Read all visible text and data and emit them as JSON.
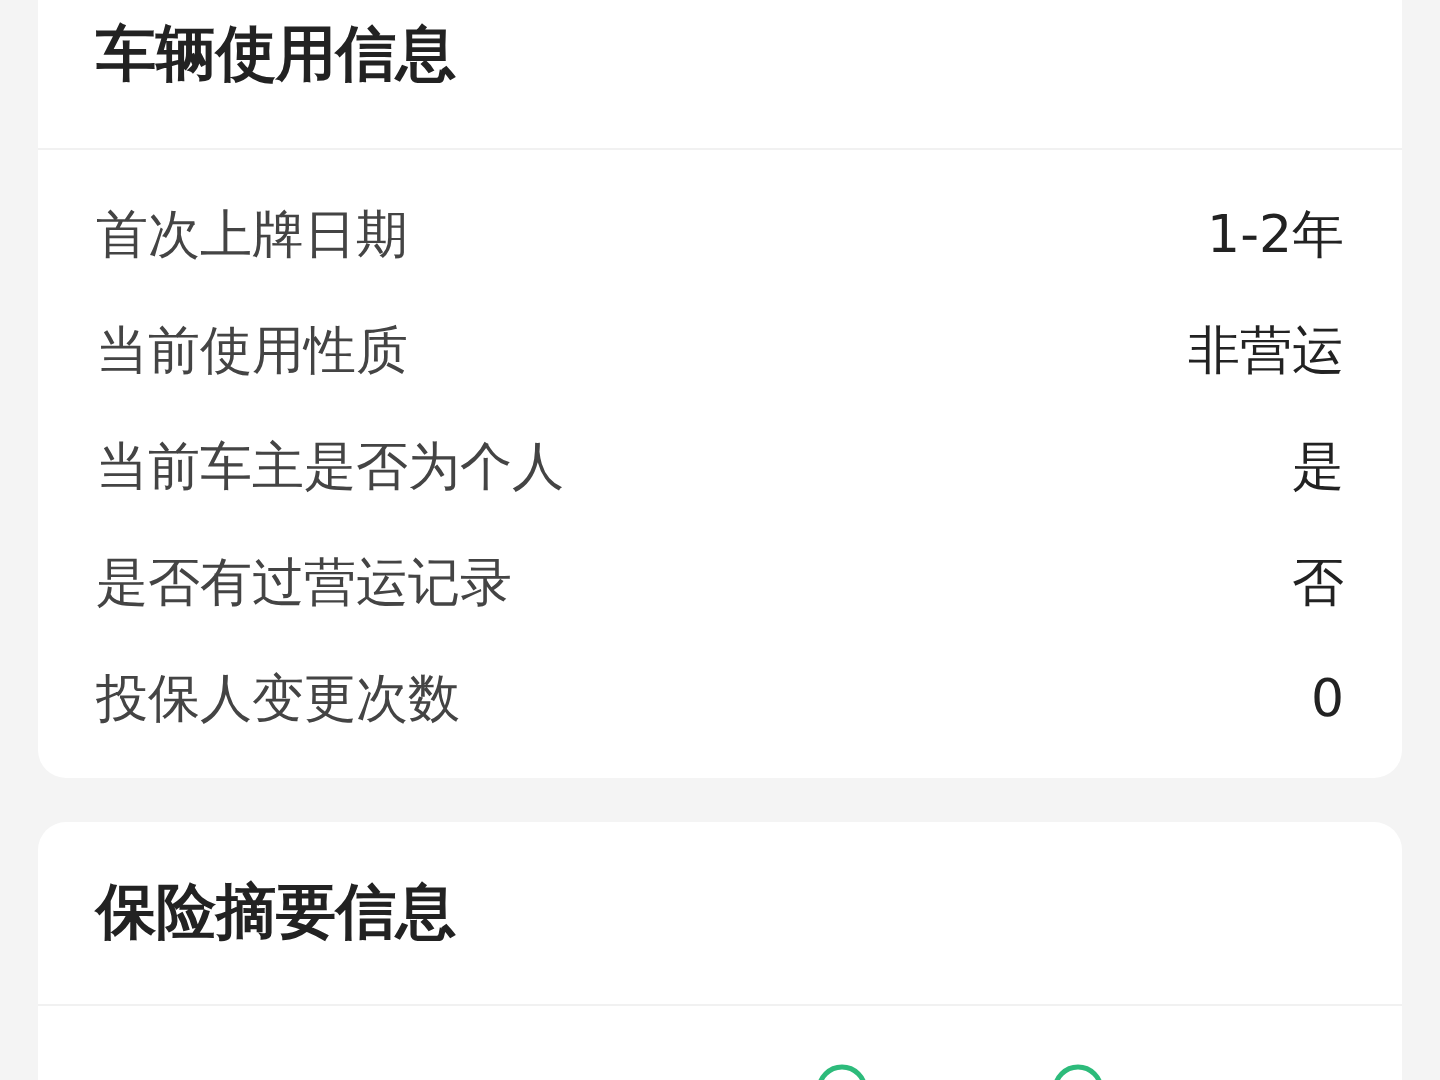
{
  "vehicle_usage": {
    "title": "车辆使用信息",
    "rows": [
      {
        "label": "首次上牌日期",
        "value": "1-2年"
      },
      {
        "label": "当前使用性质",
        "value": "非营运"
      },
      {
        "label": "当前车主是否为个人",
        "value": "是"
      },
      {
        "label": "是否有过营运记录",
        "value": "否"
      },
      {
        "label": "投保人变更次数",
        "value": "0"
      }
    ]
  },
  "insurance_summary": {
    "title": "保险摘要信息"
  }
}
